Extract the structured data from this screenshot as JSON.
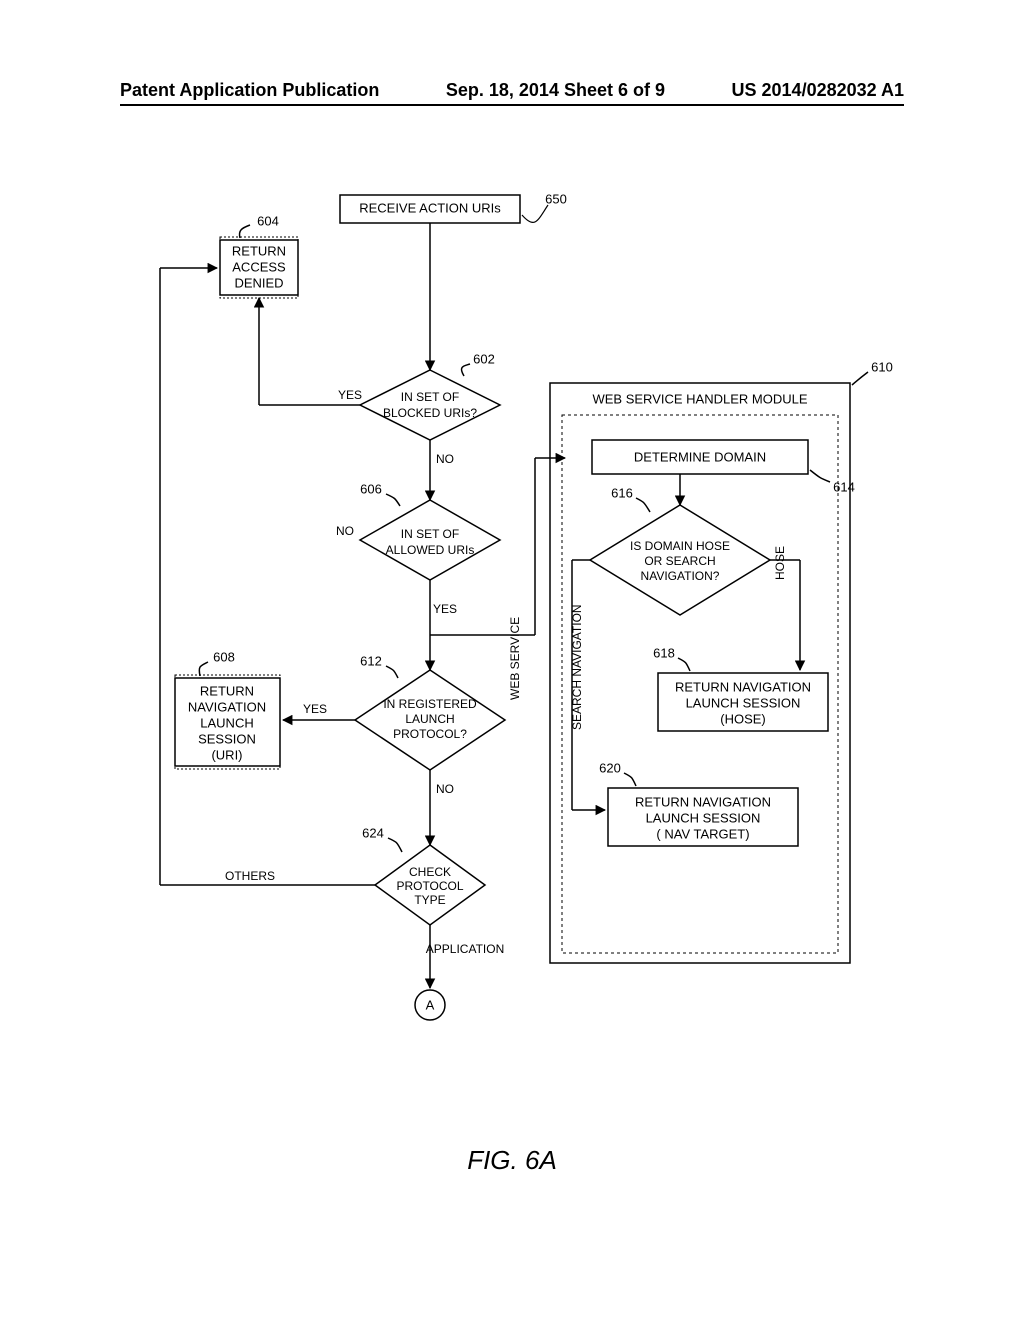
{
  "header": {
    "left": "Patent Application Publication",
    "center": "Sep. 18, 2014  Sheet 6 of 9",
    "right": "US 2014/0282032 A1"
  },
  "figure_label": "FIG. 6A",
  "boxes": {
    "b650": "RECEIVE ACTION URIs",
    "b604_l1": "RETURN",
    "b604_l2": "ACCESS",
    "b604_l3": "DENIED",
    "b602_l1": "IN SET OF",
    "b602_l2": "BLOCKED URIs?",
    "b606_l1": "IN SET OF",
    "b606_l2": "ALLOWED URIs",
    "b612_l1": "IN REGISTERED",
    "b612_l2": "LAUNCH",
    "b612_l3": "PROTOCOL?",
    "b608_l1": "RETURN",
    "b608_l2": "NAVIGATION",
    "b608_l3": "LAUNCH",
    "b608_l4": "SESSION",
    "b608_l5": "(URI)",
    "b624_l1": "CHECK",
    "b624_l2": "PROTOCOL",
    "b624_l3": "TYPE",
    "b610": "WEB SERVICE HANDLER MODULE",
    "b614": "DETERMINE DOMAIN",
    "b616_l1": "IS DOMAIN HOSE",
    "b616_l2": "OR SEARCH",
    "b616_l3": "NAVIGATION?",
    "b618_l1": "RETURN NAVIGATION",
    "b618_l2": "LAUNCH SESSION",
    "b618_l3": "(HOSE)",
    "b620_l1": "RETURN NAVIGATION",
    "b620_l2": "LAUNCH SESSION",
    "b620_l3": "( NAV TARGET)",
    "connector_A": "A"
  },
  "labels": {
    "l604": "604",
    "l650": "650",
    "l602": "602",
    "l606": "606",
    "l608": "608",
    "l612": "612",
    "l624": "624",
    "l610": "610",
    "l614": "614",
    "l616": "616",
    "l618": "618",
    "l620": "620"
  },
  "branches": {
    "yes": "YES",
    "no": "NO",
    "no2": "NO",
    "yes2": "YES",
    "yes3": "YES",
    "no3": "NO",
    "web_service": "WEB SERVICE",
    "others": "OTHERS",
    "application": "APPLICATION",
    "search_nav": "SEARCH NAVIGATION",
    "hose": "HOSE"
  }
}
